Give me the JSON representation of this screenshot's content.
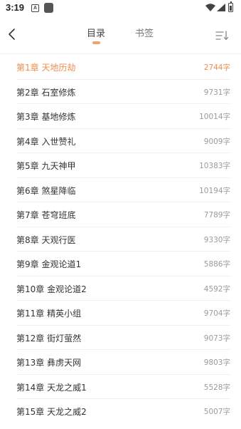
{
  "status_bar": {
    "time": "3:19",
    "notification_a": "A"
  },
  "header": {
    "tabs": [
      {
        "label": "目录",
        "active": true
      },
      {
        "label": "书签",
        "active": false
      }
    ]
  },
  "colors": {
    "accent": "#ef8d4b",
    "tab_indicator": "#f0a46a",
    "text": "#333333",
    "muted": "#9a9a9a"
  },
  "chapters": [
    {
      "title": "第1章 天地历劫",
      "words": "2744字",
      "current": true
    },
    {
      "title": "第2章 石室修炼",
      "words": "9731字"
    },
    {
      "title": "第3章 基地修炼",
      "words": "10014字"
    },
    {
      "title": "第4章 入世赞礼",
      "words": "9009字"
    },
    {
      "title": "第5章 九天神甲",
      "words": "10383字"
    },
    {
      "title": "第6章 煞星降临",
      "words": "10194字"
    },
    {
      "title": "第7章 苍穹班底",
      "words": "7789字"
    },
    {
      "title": "第8章 天观行医",
      "words": "9330字"
    },
    {
      "title": "第9章 金观论道1",
      "words": "5886字"
    },
    {
      "title": "第10章 金观论道2",
      "words": "4592字"
    },
    {
      "title": "第11章 精英小组",
      "words": "9704字"
    },
    {
      "title": "第12章 街灯萤然",
      "words": "9073字"
    },
    {
      "title": "第13章 彝虏天网",
      "words": "9803字"
    },
    {
      "title": "第14章 天龙之威1",
      "words": "5528字"
    },
    {
      "title": "第15章 天龙之威2",
      "words": "5007字"
    }
  ]
}
